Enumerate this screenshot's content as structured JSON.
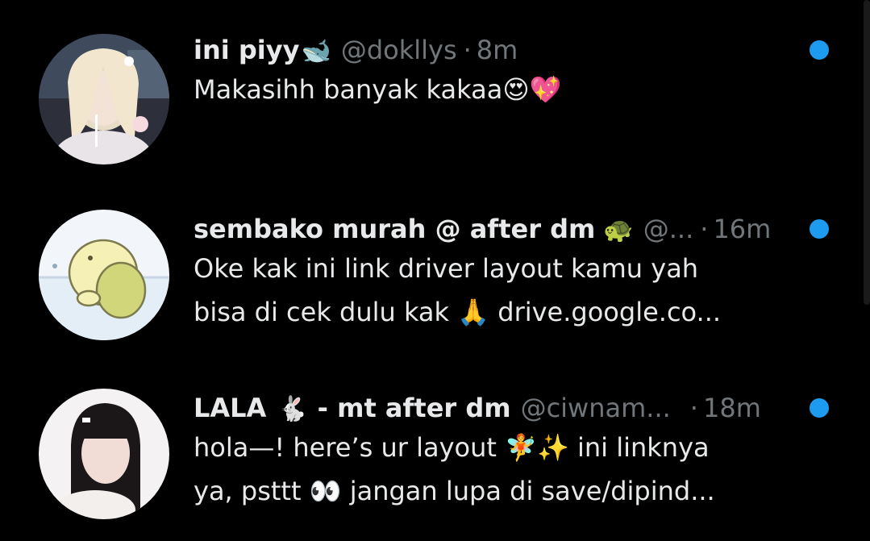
{
  "conversations": [
    {
      "name": "ini piyy",
      "name_emoji": "🐋",
      "handle": "@dokllys",
      "separator": "·",
      "time": "8m",
      "message_lines": [
        "Makasihh banyak kakaa😍💖"
      ],
      "unread": true
    },
    {
      "name": "sembako murah @ after dm",
      "name_emoji": "🐢",
      "handle": "@...",
      "separator": "·",
      "time": "16m",
      "message_lines": [
        "Oke kak ini link driver layout kamu yah",
        "bisa di cek dulu kak 🙏  drive.google.co..."
      ],
      "unread": true
    },
    {
      "name": "LALA",
      "name_emoji": "🐇",
      "name_suffix": "- mt after dm",
      "handle": "@ciwnam...",
      "separator": "·",
      "time": "18m",
      "message_lines": [
        "hola—! here’s ur layout 🧚✨ ini linknya",
        "ya, psttt 👀 jangan lupa di save/dipind..."
      ],
      "unread": true
    }
  ],
  "colors": {
    "background": "#000000",
    "primary_text": "#e7e9ea",
    "secondary_text": "#71767b",
    "unread_dot": "#1d9bf0"
  }
}
